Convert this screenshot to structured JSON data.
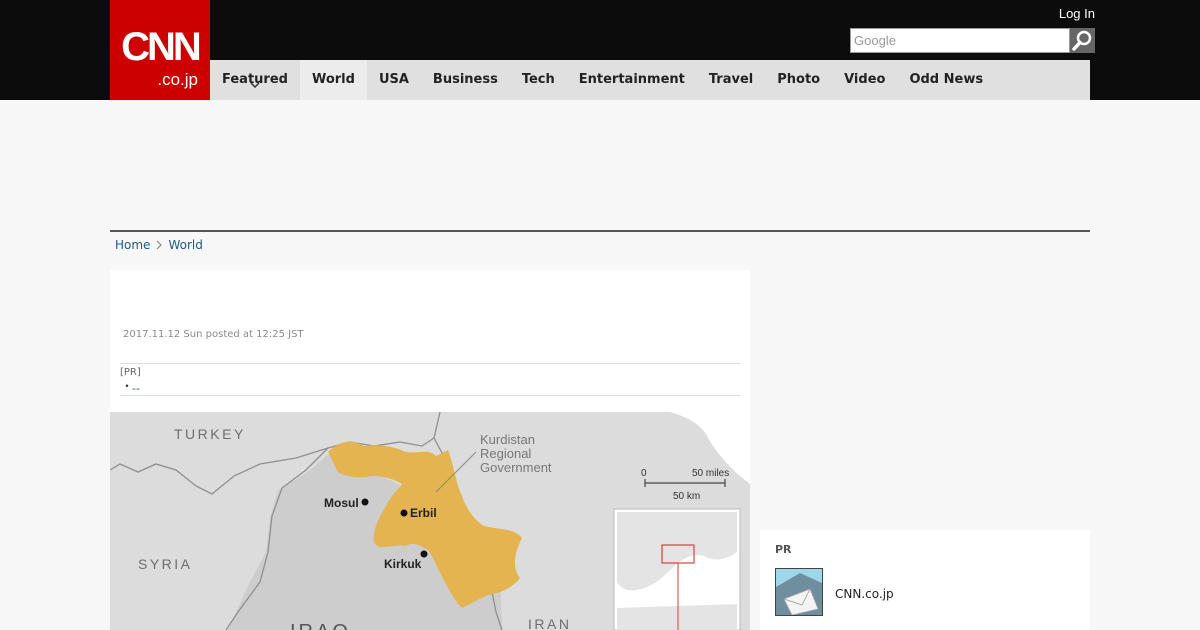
{
  "header": {
    "logo_main": "CNN",
    "logo_tld": ".co.jp",
    "login_label": "Log In",
    "search_placeholder": "Google"
  },
  "nav": {
    "items": [
      {
        "label": "Featured"
      },
      {
        "label": "World"
      },
      {
        "label": "USA"
      },
      {
        "label": "Business"
      },
      {
        "label": "Tech"
      },
      {
        "label": "Entertainment"
      },
      {
        "label": "Travel"
      },
      {
        "label": "Photo"
      },
      {
        "label": "Video"
      },
      {
        "label": "Odd News"
      }
    ]
  },
  "breadcrumb": {
    "home": "Home",
    "current": "World"
  },
  "article": {
    "timestamp": "2017.11.12 Sun posted at 12:25 JST",
    "pr_tag": "[PR]",
    "pr_bullet": "・",
    "pr_link": "--"
  },
  "map": {
    "country_turkey": "TURKEY",
    "country_syria": "SYRIA",
    "country_iraq": "IRAQ",
    "country_iran": "IRAN",
    "region_label_1": "Kurdistan",
    "region_label_2": "Regional",
    "region_label_3": "Government",
    "city_mosul": "Mosul",
    "city_erbil": "Erbil",
    "city_kirkuk": "Kirkuk",
    "scale_zero": "0",
    "scale_miles": "50 miles",
    "scale_km": "50 km",
    "colors": {
      "kurdistan_fill": "#e3b44f",
      "land_fill": "#dcdcdc",
      "iraq_fill": "#cdcdcd",
      "water_fill": "#ffffff",
      "border_stroke": "#8f8f8f",
      "locator_box": "#d0453b"
    }
  },
  "sidebar": {
    "pr_tag": "PR",
    "item_label": "CNN.co.jp",
    "item_icon": "envelope-icon"
  },
  "colors": {
    "brand_red": "#cc0000",
    "header_black": "#0c0c0c",
    "nav_gray": "#e0e0e0",
    "link_blue": "#1b5b8e"
  }
}
